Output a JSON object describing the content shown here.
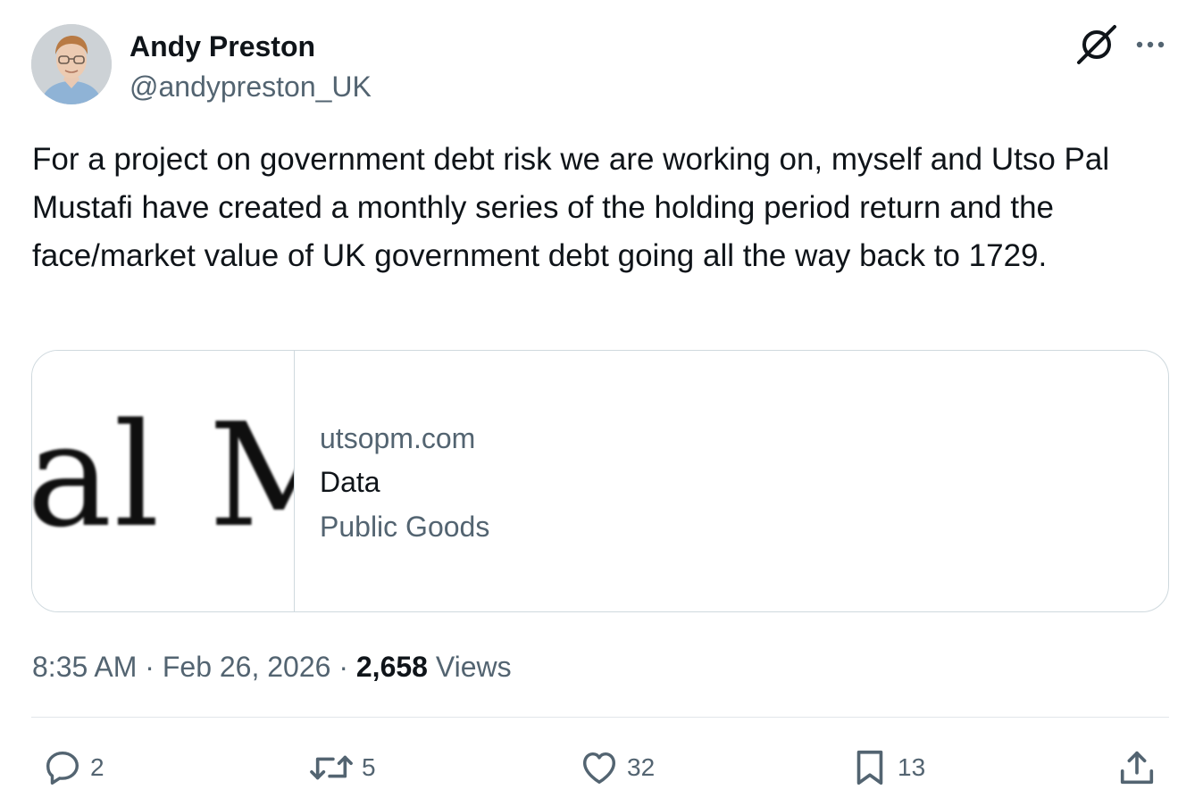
{
  "author": {
    "display_name": "Andy Preston",
    "handle": "@andypreston_UK",
    "avatar_icon": "avatar-photo"
  },
  "header_icons": {
    "grok": "grok-icon",
    "more": "more-icon"
  },
  "tweet": {
    "text": "For a project on government debt risk we are working on, myself and Utso Pal Mustafi have created a monthly series of the holding period return and the face/market value of UK government debt going all the way back to 1729."
  },
  "card": {
    "thumbnail_text": "al M",
    "domain": "utsopm.com",
    "title": "Data",
    "description": "Public Goods"
  },
  "meta": {
    "time": "8:35 AM",
    "separator1": " · ",
    "date": "Feb 26, 2026",
    "separator2": " · ",
    "views_count": "2,658",
    "views_label": " Views"
  },
  "actions": {
    "replies": "2",
    "reposts": "5",
    "likes": "32",
    "bookmarks": "13"
  },
  "colors": {
    "text": "#0f1419",
    "secondary": "#536471",
    "border": "#cfd9de"
  }
}
